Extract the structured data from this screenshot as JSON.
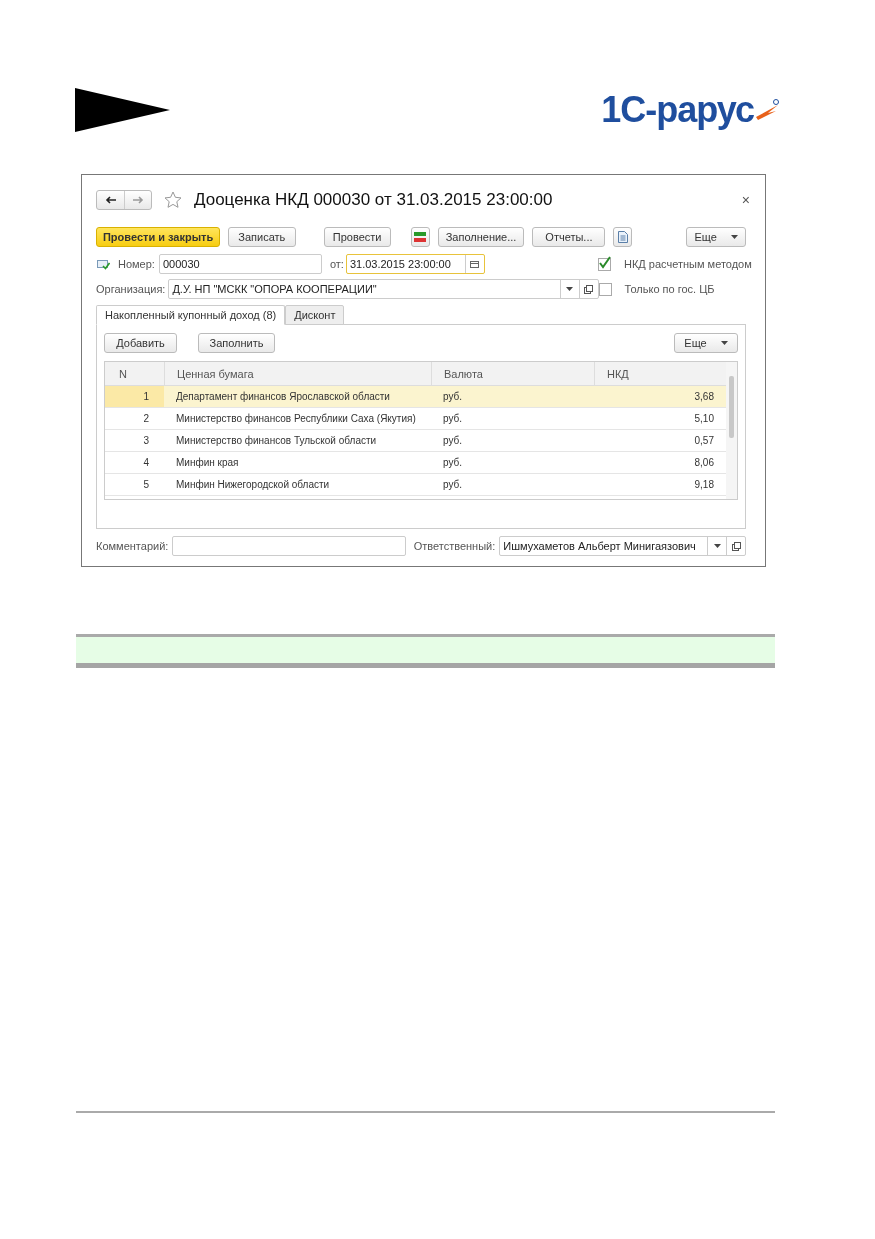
{
  "logo": {
    "text": "1С-рарус"
  },
  "window": {
    "title": "Дооценка НКД 000030 от 31.03.2015 23:00:00",
    "close": "×"
  },
  "toolbar": [
    {
      "kind": "primary",
      "label": "Провести и закрыть"
    },
    {
      "kind": "button",
      "label": "Записать"
    },
    {
      "kind": "button",
      "label": "Провести"
    },
    {
      "kind": "dtkt"
    },
    {
      "kind": "button",
      "label": "Заполнение..."
    },
    {
      "kind": "button",
      "label": "Отчеты..."
    },
    {
      "kind": "doc"
    },
    {
      "kind": "dropdown",
      "label": "Еще"
    }
  ],
  "number": {
    "label": "Номер:",
    "value": "000030"
  },
  "date": {
    "label": "от:",
    "value": "31.03.2015 23:00:00"
  },
  "organization": {
    "label": "Организация:",
    "value": "Д.У. НП \"МСКК \"ОПОРА КООПЕРАЦИИ\""
  },
  "options": [
    {
      "label": "НКД расчетным методом",
      "checked": true
    },
    {
      "label": "Только по гос. ЦБ",
      "checked": false
    }
  ],
  "tabs": [
    {
      "label": "Накопленный купонный доход (8)",
      "selected": true
    },
    {
      "label": "Дисконт",
      "selected": false
    }
  ],
  "table_buttons": {
    "add": "Добавить",
    "fill": "Заполнить",
    "more": "Еще"
  },
  "table": {
    "columns": [
      "N",
      "Ценная бумага",
      "Валюта",
      "НКД"
    ],
    "rows": [
      {
        "n": "1",
        "security": "Департамент финансов Ярославской области",
        "currency": "руб.",
        "nkd": "3,68",
        "selected": true
      },
      {
        "n": "2",
        "security": "Министерство финансов Республики Саха (Якутия)",
        "currency": "руб.",
        "nkd": "5,10",
        "selected": false
      },
      {
        "n": "3",
        "security": "Министерство финансов Тульской области",
        "currency": "руб.",
        "nkd": "0,57",
        "selected": false
      },
      {
        "n": "4",
        "security": "Минфин края",
        "currency": "руб.",
        "nkd": "8,06",
        "selected": false
      },
      {
        "n": "5",
        "security": "Минфин Нижегородской области",
        "currency": "руб.",
        "nkd": "9,18",
        "selected": false
      }
    ]
  },
  "comment": {
    "label": "Комментарий:"
  },
  "responsible": {
    "label": "Ответственный:",
    "value": "Ишмухаметов Альберт Минигаязович"
  }
}
